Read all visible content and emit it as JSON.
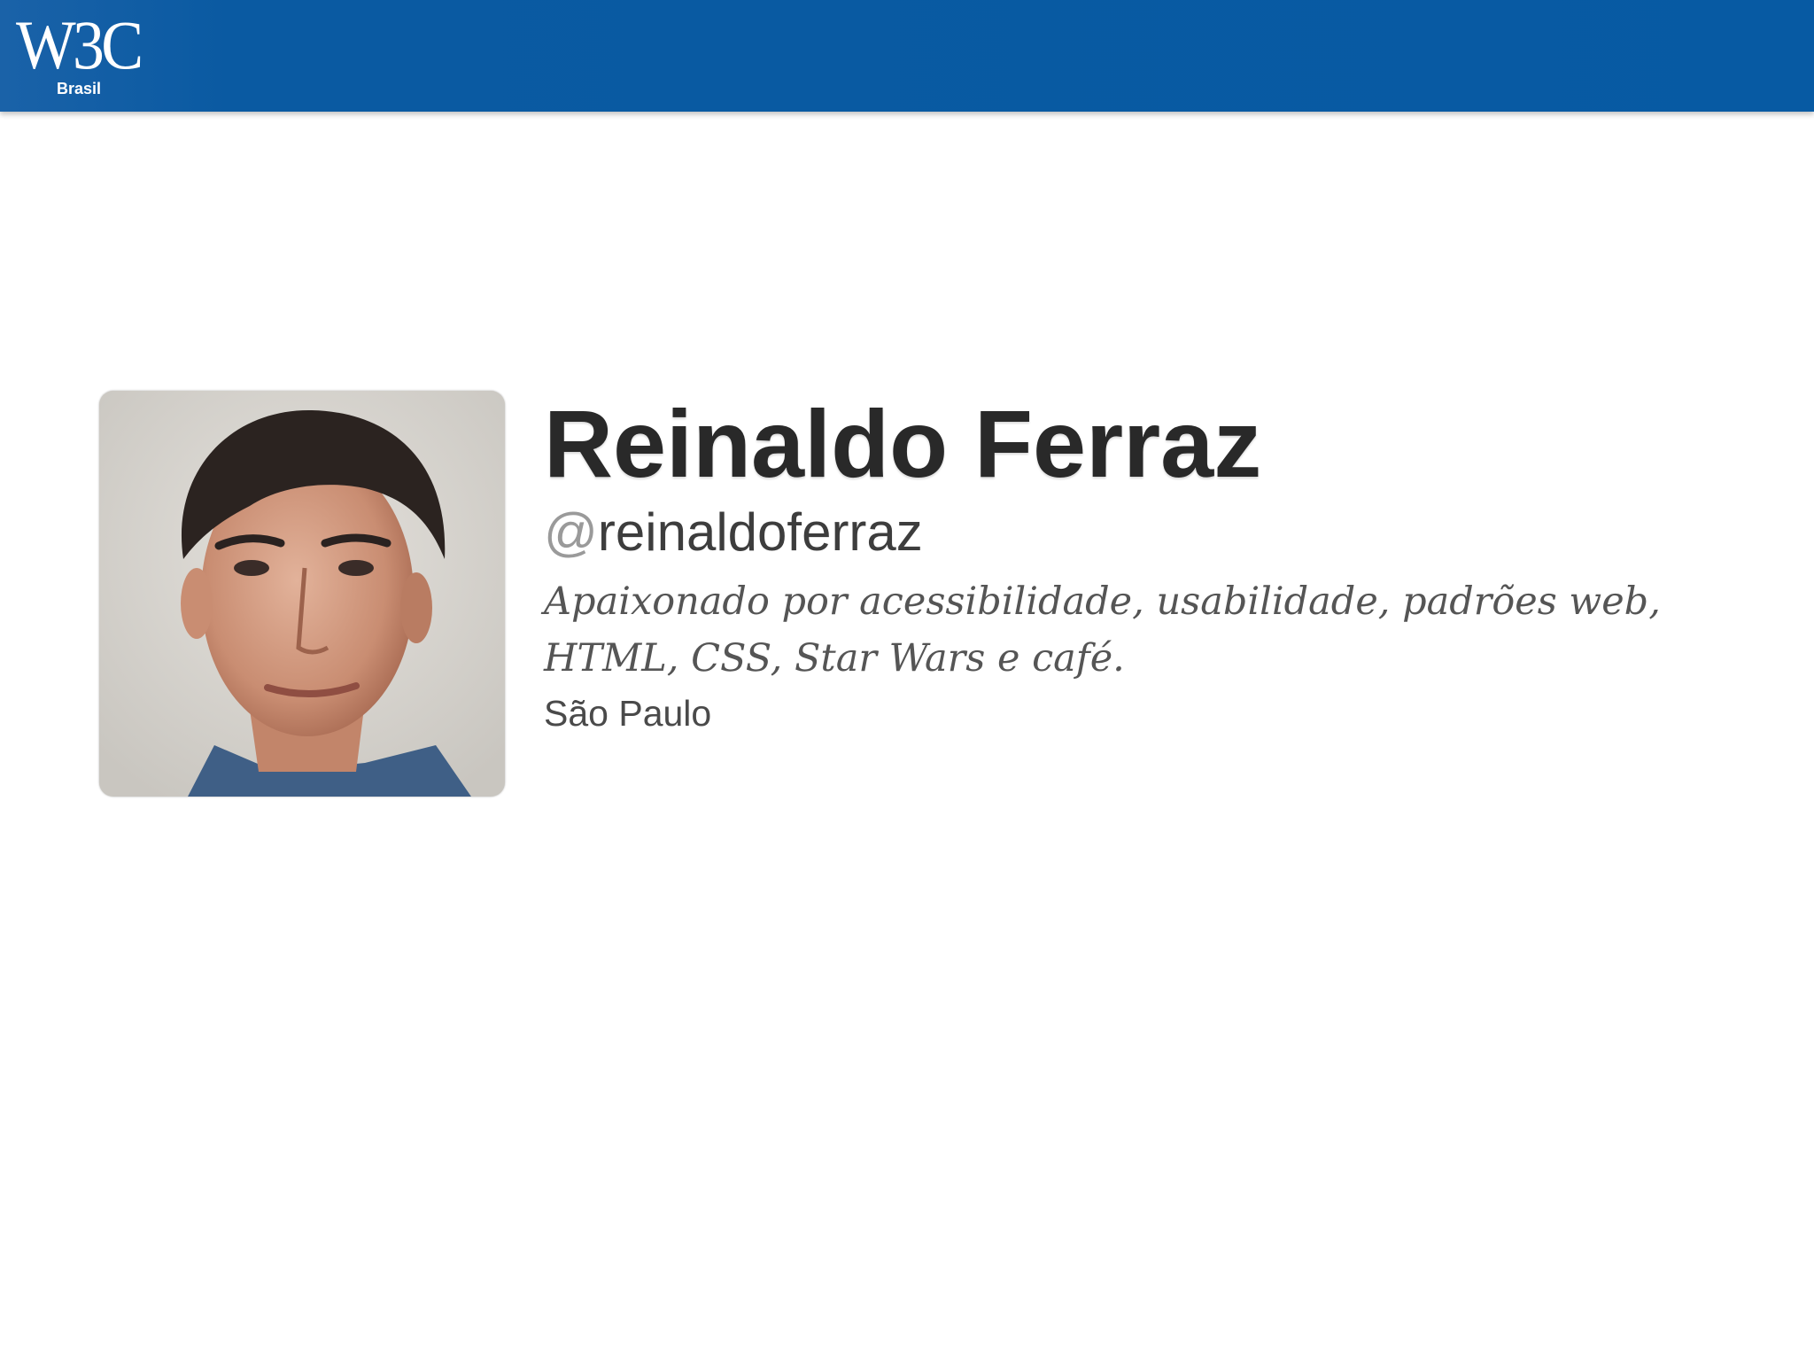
{
  "header": {
    "logo_text": "W3C",
    "logo_subtext": "Brasil",
    "bar_color": "#0a5aa2"
  },
  "profile": {
    "avatar_icon": "person-photo",
    "name": "Reinaldo Ferraz",
    "handle_at": "@",
    "handle_user": "reinaldoferraz",
    "bio": "Apaixonado por acessibilidade, usabilidade, padrões web, HTML, CSS, Star Wars e café.",
    "location": "São Paulo"
  }
}
